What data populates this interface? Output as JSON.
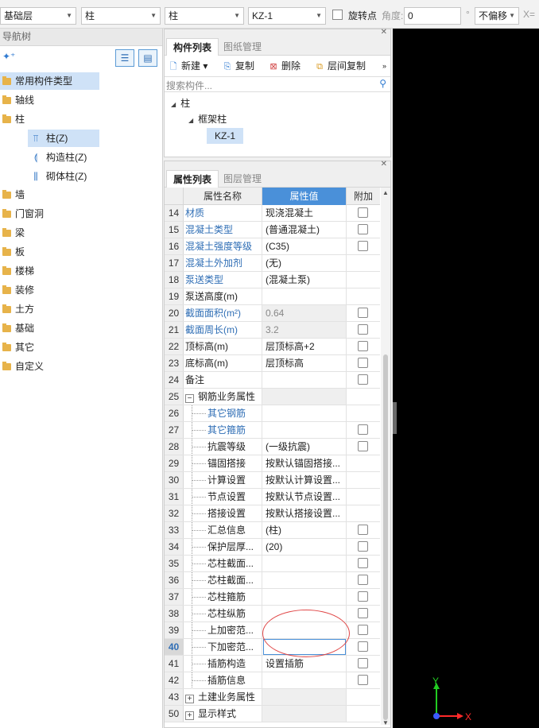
{
  "toolbar": {
    "floor": "基础层",
    "category": "柱",
    "type": "柱",
    "component": "KZ-1",
    "rotate_label": "旋转点",
    "angle_label": "角度:",
    "angle_value": "0",
    "degree": "°",
    "offset": "不偏移",
    "x_label": "X="
  },
  "nav": {
    "title": "导航树",
    "items": [
      {
        "label": "常用构件类型"
      },
      {
        "label": "轴线"
      },
      {
        "label": "柱"
      },
      {
        "label": "柱(Z)"
      },
      {
        "label": "构造柱(Z)"
      },
      {
        "label": "砌体柱(Z)"
      },
      {
        "label": "墙"
      },
      {
        "label": "门窗洞"
      },
      {
        "label": "梁"
      },
      {
        "label": "板"
      },
      {
        "label": "楼梯"
      },
      {
        "label": "装修"
      },
      {
        "label": "土方"
      },
      {
        "label": "基础"
      },
      {
        "label": "其它"
      },
      {
        "label": "自定义"
      }
    ]
  },
  "complist": {
    "tab_active": "构件列表",
    "tab_other": "图纸管理",
    "btn_new": "新建",
    "btn_copy": "复制",
    "btn_delete": "删除",
    "btn_floor_copy": "层间复制",
    "search_placeholder": "搜索构件...",
    "tree": [
      "柱",
      "框架柱",
      "KZ-1"
    ]
  },
  "props": {
    "tab_active": "属性列表",
    "tab_other": "图层管理",
    "col_name": "属性名称",
    "col_value": "属性值",
    "col_add": "附加",
    "rows": [
      {
        "num": "14",
        "name": "材质",
        "value": "现浇混凝土"
      },
      {
        "num": "15",
        "name": "混凝土类型",
        "value": "(普通混凝土)"
      },
      {
        "num": "16",
        "name": "混凝土强度等级",
        "value": "(C35)"
      },
      {
        "num": "17",
        "name": "混凝土外加剂",
        "value": "(无)"
      },
      {
        "num": "18",
        "name": "泵送类型",
        "value": "(混凝土泵)"
      },
      {
        "num": "19",
        "name": "泵送高度(m)",
        "value": ""
      },
      {
        "num": "20",
        "name": "截面面积(m²)",
        "value": "0.64"
      },
      {
        "num": "21",
        "name": "截面周长(m)",
        "value": "3.2"
      },
      {
        "num": "22",
        "name": "顶标高(m)",
        "value": "层顶标高+2"
      },
      {
        "num": "23",
        "name": "底标高(m)",
        "value": "层顶标高"
      },
      {
        "num": "24",
        "name": "备注",
        "value": ""
      },
      {
        "num": "25",
        "name": "钢筋业务属性",
        "value": ""
      },
      {
        "num": "26",
        "name": "其它钢筋",
        "value": ""
      },
      {
        "num": "27",
        "name": "其它箍筋",
        "value": ""
      },
      {
        "num": "28",
        "name": "抗震等级",
        "value": "(一级抗震)"
      },
      {
        "num": "29",
        "name": "锚固搭接",
        "value": "按默认锚固搭接..."
      },
      {
        "num": "30",
        "name": "计算设置",
        "value": "按默认计算设置..."
      },
      {
        "num": "31",
        "name": "节点设置",
        "value": "按默认节点设置..."
      },
      {
        "num": "32",
        "name": "搭接设置",
        "value": "按默认搭接设置..."
      },
      {
        "num": "33",
        "name": "汇总信息",
        "value": "(柱)"
      },
      {
        "num": "34",
        "name": "保护层厚...",
        "value": "(20)"
      },
      {
        "num": "35",
        "name": "芯柱截面...",
        "value": ""
      },
      {
        "num": "36",
        "name": "芯柱截面...",
        "value": ""
      },
      {
        "num": "37",
        "name": "芯柱箍筋",
        "value": ""
      },
      {
        "num": "38",
        "name": "芯柱纵筋",
        "value": ""
      },
      {
        "num": "39",
        "name": "上加密范...",
        "value": ""
      },
      {
        "num": "40",
        "name": "下加密范...",
        "value": ""
      },
      {
        "num": "41",
        "name": "插筋构造",
        "value": "设置插筋"
      },
      {
        "num": "42",
        "name": "插筋信息",
        "value": ""
      },
      {
        "num": "43",
        "name": "土建业务属性",
        "value": ""
      },
      {
        "num": "50",
        "name": "显示样式",
        "value": ""
      }
    ]
  },
  "axes": {
    "y": "Y",
    "x": "X"
  },
  "colors": {
    "accent": "#4a90d9",
    "selected_row": "#cfe2f7",
    "viewport": "#000000",
    "annotation": "#e04848"
  }
}
